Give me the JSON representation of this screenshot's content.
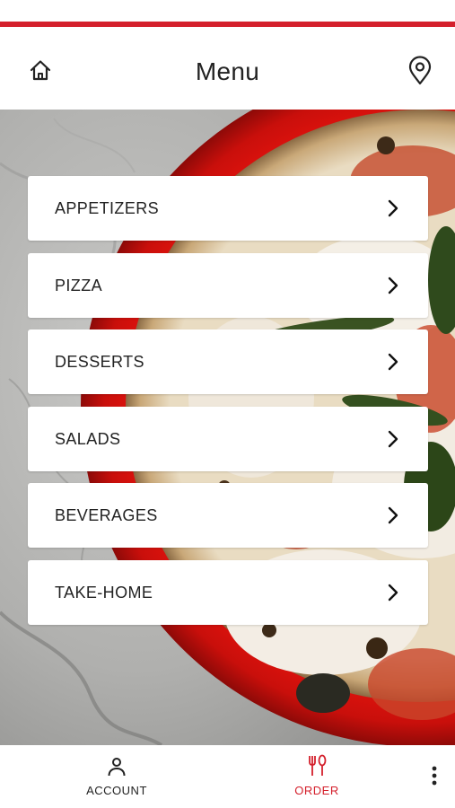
{
  "theme": {
    "accent": "#d4202c",
    "text": "#222222",
    "surface": "#ffffff"
  },
  "header": {
    "title": "Menu",
    "left_icon": "home-icon",
    "right_icon": "location-pin-icon"
  },
  "menu": {
    "items": [
      {
        "label": "APPETIZERS"
      },
      {
        "label": "PIZZA"
      },
      {
        "label": "DESSERTS"
      },
      {
        "label": "SALADS"
      },
      {
        "label": "BEVERAGES"
      },
      {
        "label": "TAKE-HOME"
      }
    ],
    "item_icon": "chevron-right-icon"
  },
  "bottom_nav": {
    "account": {
      "label": "ACCOUNT",
      "icon": "person-icon"
    },
    "order": {
      "label": "ORDER",
      "icon": "fork-knife-icon",
      "active": true
    },
    "more": {
      "icon": "more-vertical-icon"
    }
  }
}
